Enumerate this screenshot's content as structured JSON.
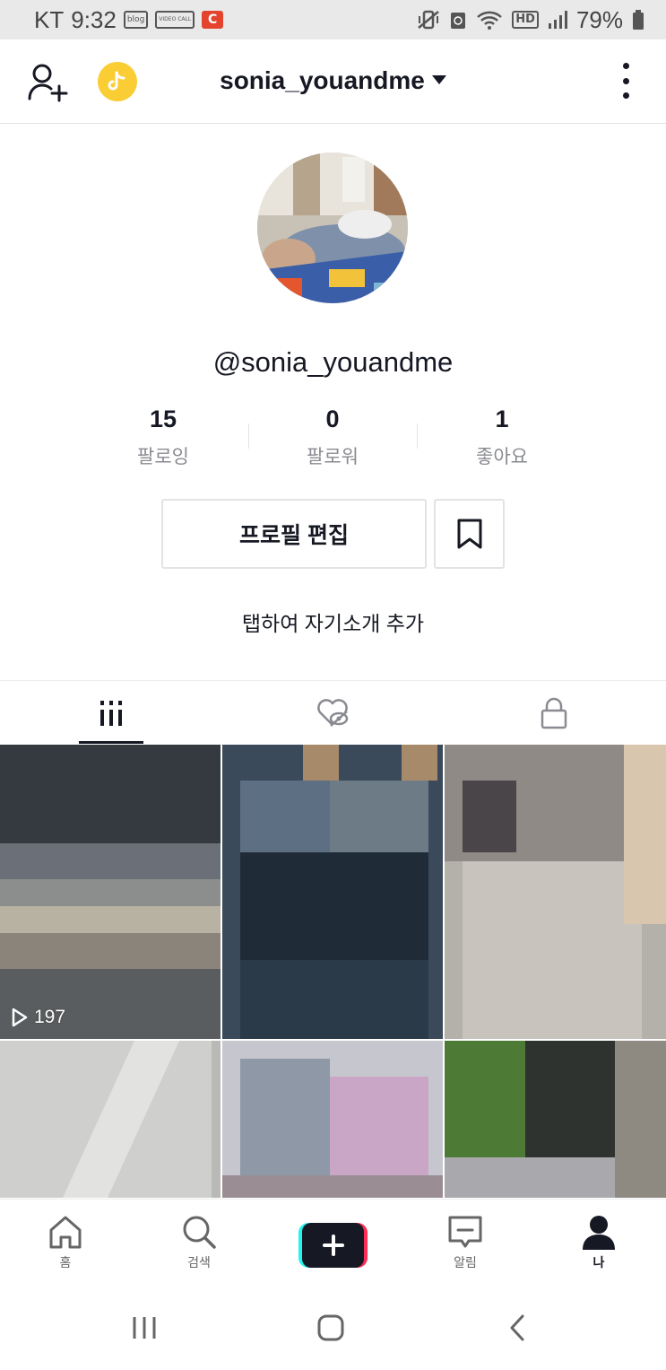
{
  "status_bar": {
    "carrier": "KT",
    "time": "9:32",
    "notif_blog": "blog",
    "notif_video": "VIDEO CALL",
    "notif_c": "C",
    "hd_label": "HD",
    "battery": "79%"
  },
  "header": {
    "username": "sonia_youandme"
  },
  "profile": {
    "handle": "@sonia_youandme",
    "stats": [
      {
        "value": "15",
        "label": "팔로잉"
      },
      {
        "value": "0",
        "label": "팔로워"
      },
      {
        "value": "1",
        "label": "좋아요"
      }
    ],
    "edit_button": "프로필 편집",
    "bio_prompt": "탭하여 자기소개 추가"
  },
  "videos": [
    {
      "views": "197"
    },
    {
      "views": ""
    },
    {
      "views": ""
    },
    {
      "views": ""
    },
    {
      "views": ""
    },
    {
      "views": ""
    }
  ],
  "bottom_nav": {
    "home": "홈",
    "search": "검색",
    "inbox": "알림",
    "me": "나"
  },
  "colors": {
    "accent_red": "#fe2c55",
    "accent_cyan": "#25f4ee",
    "text_primary": "#161823",
    "text_secondary": "#8a8b91",
    "coin_yellow": "#f9cd33"
  }
}
